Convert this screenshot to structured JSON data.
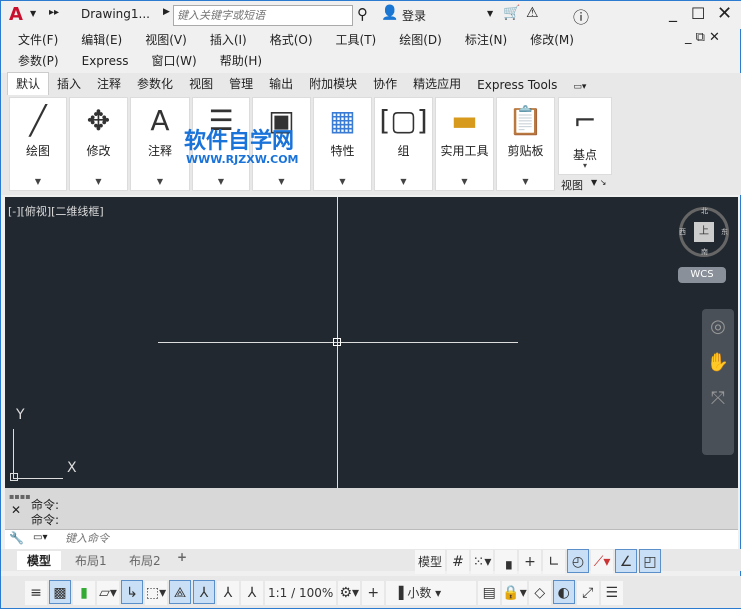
{
  "title": {
    "doc": "Drawing1...",
    "search_placeholder": "键入关键字或短语",
    "login": "登录"
  },
  "menu": {
    "row1": [
      "文件(F)",
      "编辑(E)",
      "视图(V)",
      "插入(I)",
      "格式(O)",
      "工具(T)",
      "绘图(D)",
      "标注(N)",
      "修改(M)"
    ],
    "row2": [
      "参数(P)",
      "Express",
      "窗口(W)",
      "帮助(H)"
    ]
  },
  "ribbon_tabs": [
    "默认",
    "插入",
    "注释",
    "参数化",
    "视图",
    "管理",
    "输出",
    "附加模块",
    "协作",
    "精选应用",
    "Express Tools"
  ],
  "panels": [
    {
      "label": "绘图",
      "icon": "line-icon"
    },
    {
      "label": "修改",
      "icon": "move-icon"
    },
    {
      "label": "注释",
      "icon": "text-icon"
    },
    {
      "label": "",
      "icon": "layers-icon"
    },
    {
      "label": "",
      "icon": "block-icon"
    },
    {
      "label": "特性",
      "icon": "properties-icon"
    },
    {
      "label": "组",
      "icon": "group-icon"
    },
    {
      "label": "实用工具",
      "icon": "measure-icon"
    },
    {
      "label": "剪贴板",
      "icon": "clipboard-icon"
    }
  ],
  "basepoint": {
    "label": "基点",
    "view": "视图"
  },
  "watermark": {
    "name": "软件自学网",
    "url": "WWW.RJZXW.COM"
  },
  "viewport": {
    "label": "[-][俯视][二维线框]",
    "compass": {
      "n": "北",
      "s": "南",
      "e": "东",
      "w": "西",
      "top": "上"
    },
    "wcs": "WCS",
    "axis_y": "Y",
    "axis_x": "X"
  },
  "command": {
    "history": [
      "命令:",
      "命令:"
    ],
    "placeholder": "键入命令"
  },
  "layout_tabs": [
    "模型",
    "布局1",
    "布局2",
    "+"
  ],
  "status": {
    "model": "模型",
    "scale": "1:1 / 100%",
    "units": "小数"
  }
}
